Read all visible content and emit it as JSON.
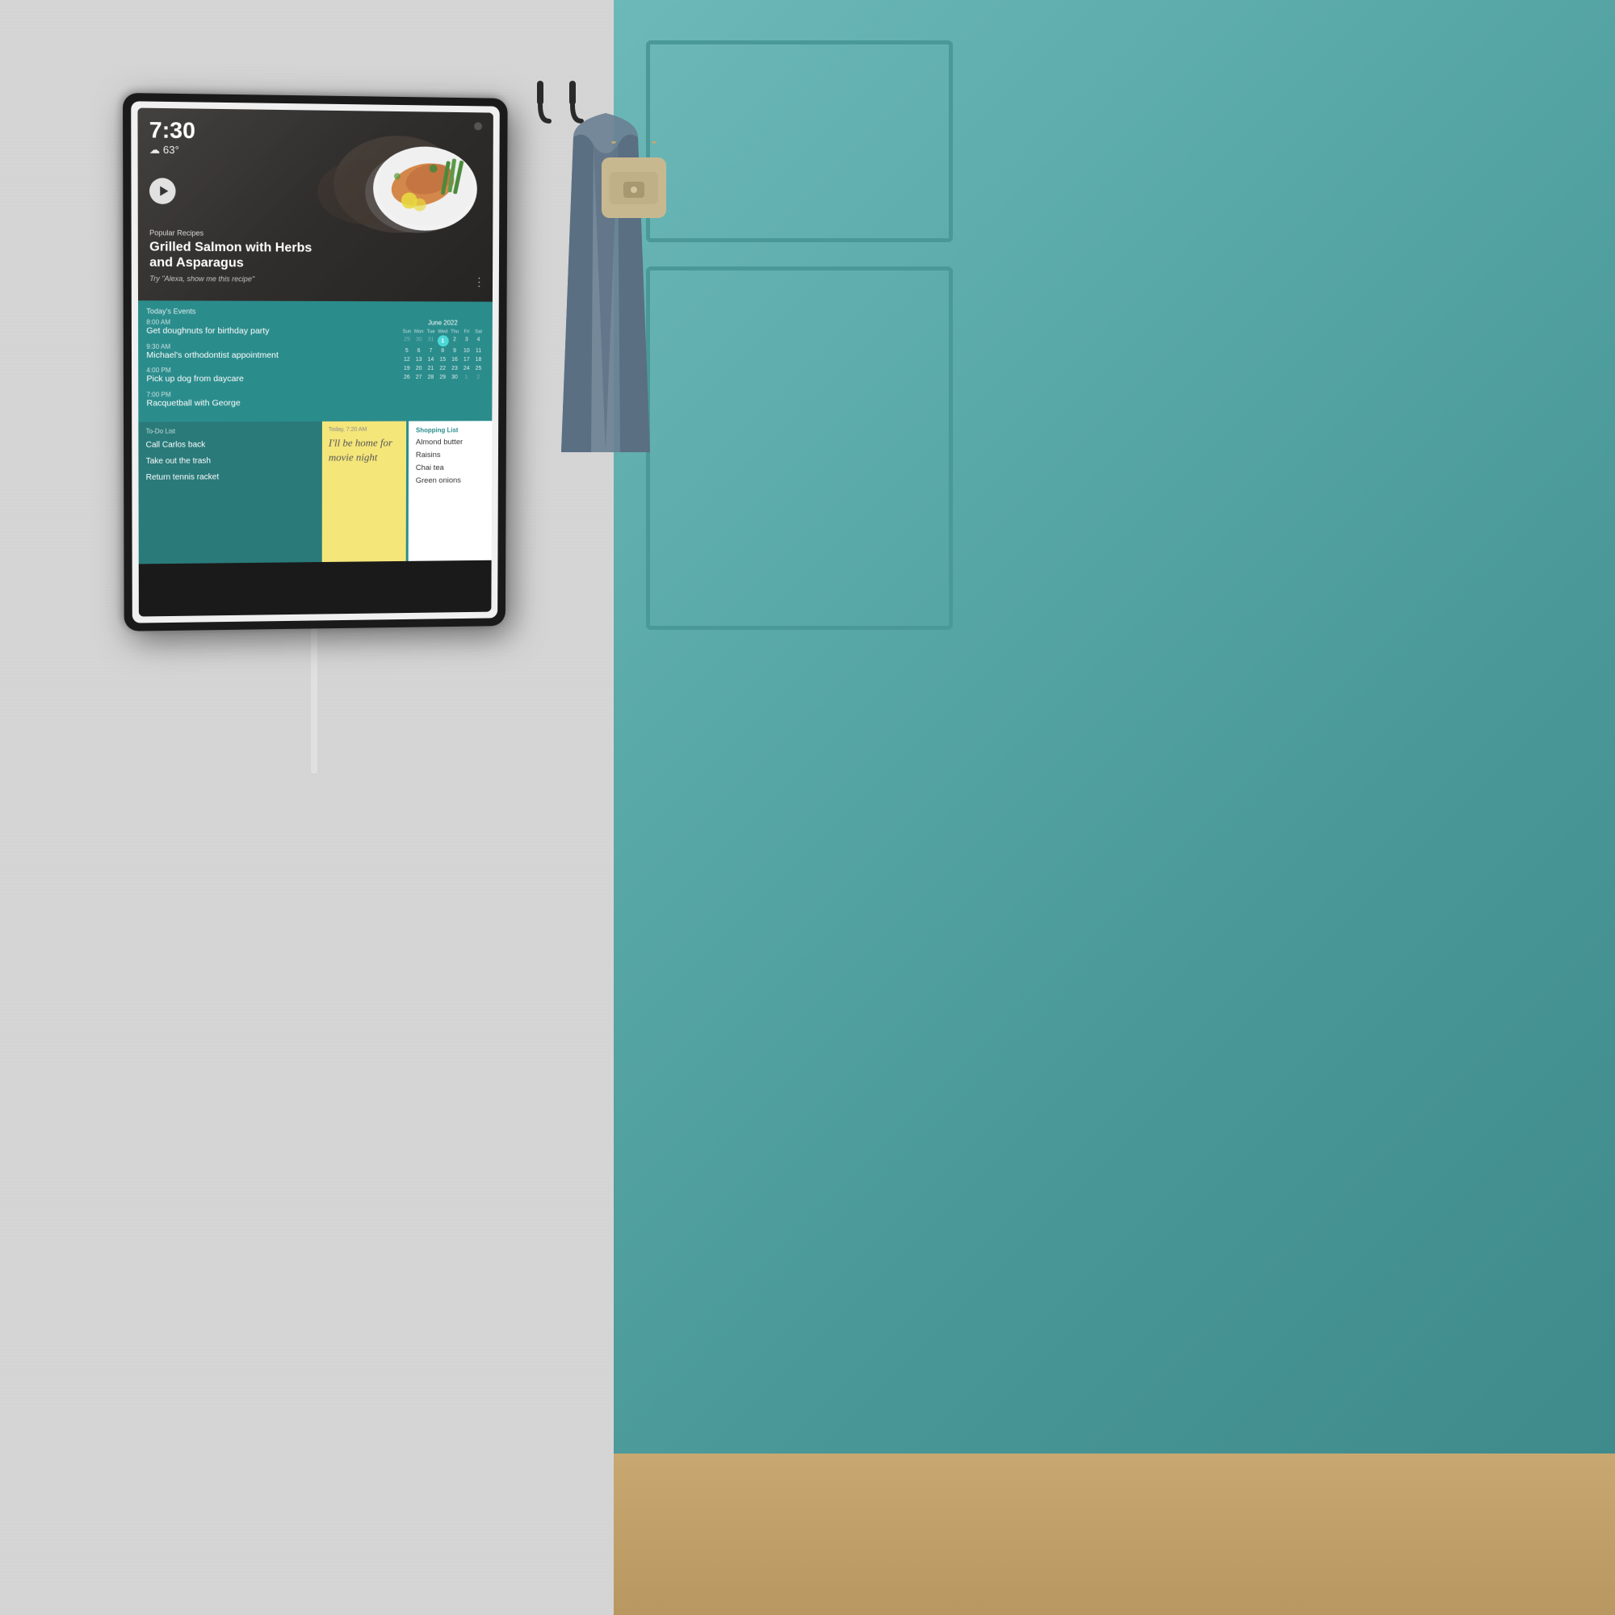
{
  "scene": {
    "background_left_color": "#d0d0d0",
    "background_right_color": "#5aacac"
  },
  "device": {
    "frame_color": "#1a1a1a",
    "bezel_color": "#f0f0f0"
  },
  "screen": {
    "time": "7:30",
    "weather": "☁ 63°",
    "camera_dot": true,
    "hero": {
      "play_button": true,
      "recipe_label": "Popular Recipes",
      "recipe_title": "Grilled Salmon with Herbs and Asparagus",
      "recipe_hint": "Try \"Alexa, show me this recipe\""
    },
    "calendar": {
      "section_title": "Today's Events",
      "month_label": "June 2022",
      "day_headers": [
        "Sun",
        "Mon",
        "Tue",
        "Wed",
        "Thu",
        "Fri",
        "Sat"
      ],
      "days": [
        {
          "label": "29",
          "type": "other-month"
        },
        {
          "label": "30",
          "type": "other-month"
        },
        {
          "label": "31",
          "type": "other-month"
        },
        {
          "label": "1",
          "type": "today"
        },
        {
          "label": "2",
          "type": "normal"
        },
        {
          "label": "3",
          "type": "normal"
        },
        {
          "label": "4",
          "type": "normal"
        },
        {
          "label": "5",
          "type": "normal"
        },
        {
          "label": "6",
          "type": "normal"
        },
        {
          "label": "7",
          "type": "normal"
        },
        {
          "label": "8",
          "type": "normal"
        },
        {
          "label": "9",
          "type": "normal"
        },
        {
          "label": "10",
          "type": "normal"
        },
        {
          "label": "11",
          "type": "normal"
        },
        {
          "label": "12",
          "type": "normal"
        },
        {
          "label": "13",
          "type": "normal"
        },
        {
          "label": "14",
          "type": "normal"
        },
        {
          "label": "15",
          "type": "normal"
        },
        {
          "label": "16",
          "type": "normal"
        },
        {
          "label": "17",
          "type": "normal"
        },
        {
          "label": "18",
          "type": "normal"
        },
        {
          "label": "19",
          "type": "normal"
        },
        {
          "label": "20",
          "type": "normal"
        },
        {
          "label": "21",
          "type": "normal"
        },
        {
          "label": "22",
          "type": "normal"
        },
        {
          "label": "23",
          "type": "normal"
        },
        {
          "label": "24",
          "type": "normal"
        },
        {
          "label": "25",
          "type": "normal"
        },
        {
          "label": "26",
          "type": "normal"
        },
        {
          "label": "27",
          "type": "normal"
        },
        {
          "label": "28",
          "type": "normal"
        },
        {
          "label": "29",
          "type": "normal"
        },
        {
          "label": "30",
          "type": "normal"
        },
        {
          "label": "1",
          "type": "other-month"
        },
        {
          "label": "2",
          "type": "other-month"
        }
      ],
      "events": [
        {
          "time": "8:00 AM",
          "title": "Get doughnuts for birthday party"
        },
        {
          "time": "9:30 AM",
          "title": "Michael's orthodontist appointment"
        },
        {
          "time": "4:00 PM",
          "title": "Pick up dog from daycare"
        },
        {
          "time": "7:00 PM",
          "title": "Racquetball with George"
        }
      ]
    },
    "todo": {
      "title": "To-Do List",
      "items": [
        "Call Carlos back",
        "Take out the trash",
        "Return tennis racket"
      ]
    },
    "sticky": {
      "timestamp": "Today, 7:20 AM",
      "text": "I'll be home for movie night"
    },
    "shopping": {
      "title": "Shopping List",
      "items": [
        "Almond butter",
        "Raisins",
        "Chai tea",
        "Green onions"
      ]
    }
  }
}
